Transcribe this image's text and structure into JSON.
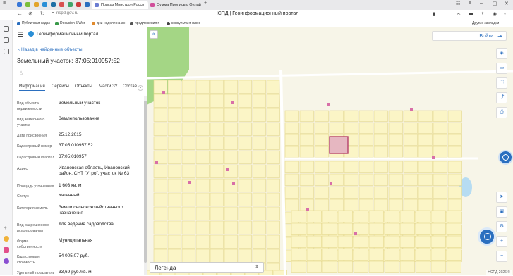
{
  "browser": {
    "tabs": [
      {
        "label": "Приказ Минстроя Росси",
        "color": "#6b7cd1"
      },
      {
        "label": "Сумма Прописью Онлай",
        "color": "#d14f9a"
      }
    ],
    "url": "nspd.gov.ru",
    "page_title": "НСПД | Геоинформационный портал",
    "bookmarks": [
      {
        "label": "Публичная кадас",
        "color": "#2b6fbf"
      },
      {
        "label": "Docusion 5 Wor",
        "color": "#3a9a4a"
      },
      {
        "label": "дни недели на ан",
        "color": "#e08a2d"
      },
      {
        "label": "предложения п",
        "color": "#555555"
      },
      {
        "label": "консультант плюс",
        "color": "#444444"
      }
    ],
    "other_bookmarks": "Другие закладки"
  },
  "panel": {
    "portal_name": "Геоинформационный портал",
    "back_link": "Назад в найденные объекты",
    "object_title": "Земельный участок: 37:05:010957:52",
    "tabs": [
      "Информация",
      "Сервисы",
      "Объекты",
      "Части ЗУ",
      "Состав"
    ],
    "rows": [
      {
        "label": "Вид объекта недвижимости",
        "value": "Земельный участок"
      },
      {
        "label": "Вид земельного участка",
        "value": "Землепользование"
      },
      {
        "label": "Дата присвоения",
        "value": "25.12.2015"
      },
      {
        "label": "Кадастровый номер",
        "value": "37:05:010957:52"
      },
      {
        "label": "Кадастровый квартал",
        "value": "37:05:010957"
      },
      {
        "label": "Адрес",
        "value": "Ивановская область, Ивановский район, СНТ \"Утро\", участок № 63"
      },
      {
        "label": "Площадь уточненная",
        "value": "1 603 кв. м"
      },
      {
        "label": "Статус",
        "value": "Учтенный"
      },
      {
        "label": "Категория земель",
        "value": "Земли сельскохозяйственного назначения"
      },
      {
        "label": "Вид разрешенного использования",
        "value": "для ведения садоводства"
      },
      {
        "label": "Форма собственности",
        "value": "Муниципальная"
      },
      {
        "label": "Кадастровая стоимость",
        "value": "54 005,07 руб."
      },
      {
        "label": "Удельный показатель",
        "value": "33,69 руб./кв. м"
      }
    ]
  },
  "map": {
    "login_label": "Войти",
    "legend_label": "Легенда",
    "copyright": "НСПД 2026 ©",
    "colors": {
      "parcel_fill": "#fbf5c6",
      "parcel_stroke": "#e5d88a",
      "selected_fill": "#e6b7c1",
      "selected_stroke": "#b5406c",
      "forest": "#a4d685",
      "water": "#b6dcf2",
      "marker": "#d86fa8",
      "accent": "#2b6fbf"
    }
  }
}
